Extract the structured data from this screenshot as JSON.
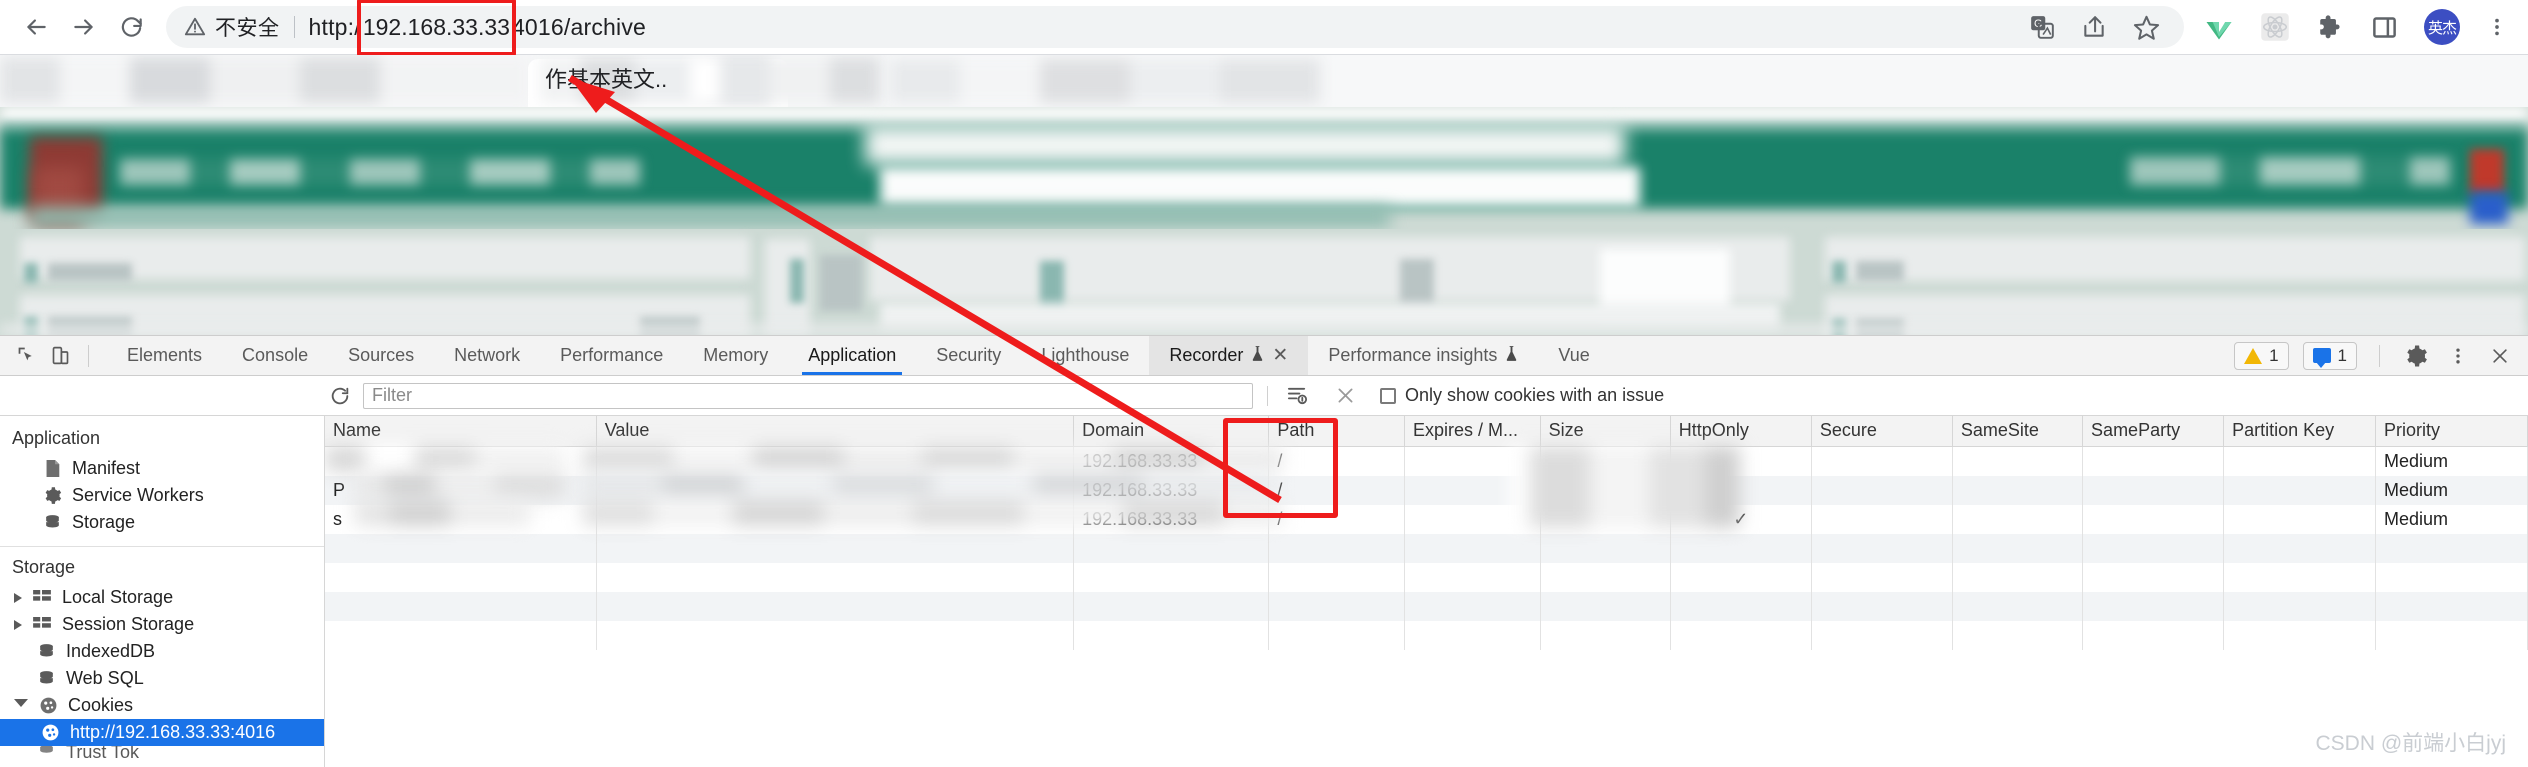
{
  "browser": {
    "nav": {
      "back_icon": "arrow-left-icon",
      "forward_icon": "arrow-right-icon",
      "reload_icon": "reload-icon"
    },
    "omnibox": {
      "security_label": "不安全",
      "warning_icon": "warning-triangle-icon",
      "url_prefix": "http:/",
      "url_highlight": "192.168.33.33",
      "url_suffix": "4016/archive",
      "translate_icon": "google-translate-icon",
      "share_icon": "share-icon",
      "bookmark_icon": "star-icon"
    },
    "actions": [
      {
        "name": "vue-devtools-icon",
        "label": "Vue"
      },
      {
        "name": "react-devtools-icon",
        "label": "React"
      },
      {
        "name": "extensions-puzzle-icon",
        "label": "Extensions"
      },
      {
        "name": "side-panel-icon",
        "label": "Side panel"
      },
      {
        "name": "profile-avatar",
        "label": "英杰"
      },
      {
        "name": "chrome-menu-icon",
        "label": "⋮"
      }
    ],
    "tab": {
      "title": "作基本英文.."
    }
  },
  "devtools": {
    "tools": {
      "inspect_icon": "inspect-element-icon",
      "device_icon": "device-toolbar-icon"
    },
    "tabs": [
      {
        "label": "Elements",
        "active": false,
        "flask": false,
        "closeable": false
      },
      {
        "label": "Console",
        "active": false,
        "flask": false,
        "closeable": false
      },
      {
        "label": "Sources",
        "active": false,
        "flask": false,
        "closeable": false
      },
      {
        "label": "Network",
        "active": false,
        "flask": false,
        "closeable": false
      },
      {
        "label": "Performance",
        "active": false,
        "flask": false,
        "closeable": false
      },
      {
        "label": "Memory",
        "active": false,
        "flask": false,
        "closeable": false
      },
      {
        "label": "Application",
        "active": true,
        "flask": false,
        "closeable": false
      },
      {
        "label": "Security",
        "active": false,
        "flask": false,
        "closeable": false
      },
      {
        "label": "Lighthouse",
        "active": false,
        "flask": false,
        "closeable": false
      },
      {
        "label": "Recorder",
        "active": false,
        "flask": true,
        "closeable": true,
        "boxed": true
      },
      {
        "label": "Performance insights",
        "active": false,
        "flask": true,
        "closeable": false
      },
      {
        "label": "Vue",
        "active": false,
        "flask": false,
        "closeable": false
      }
    ],
    "status": {
      "warning_count": "1",
      "message_count": "1",
      "settings_icon": "gear-icon",
      "more_icon": "more-vertical-icon",
      "close_icon": "close-icon"
    },
    "filterbar": {
      "refresh_icon": "refresh-icon",
      "filter_placeholder": "Filter",
      "filter_value": "",
      "clear_cookies_icon": "clear-cookies-icon",
      "clear_filter_icon": "clear-x-icon",
      "issue_checkbox_label": "Only show cookies with an issue",
      "issue_checkbox_checked": false
    },
    "sidebar": {
      "application_title": "Application",
      "application_items": [
        {
          "label": "Manifest",
          "icon": "manifest-file-icon"
        },
        {
          "label": "Service Workers",
          "icon": "gear-icon"
        },
        {
          "label": "Storage",
          "icon": "database-icon"
        }
      ],
      "storage_title": "Storage",
      "storage_items": [
        {
          "label": "Local Storage",
          "icon": "grid-storage-icon",
          "arrow": "collapsed"
        },
        {
          "label": "Session Storage",
          "icon": "grid-storage-icon",
          "arrow": "collapsed"
        },
        {
          "label": "IndexedDB",
          "icon": "database-icon",
          "arrow": "none"
        },
        {
          "label": "Web SQL",
          "icon": "database-icon",
          "arrow": "none"
        },
        {
          "label": "Cookies",
          "icon": "cookie-icon",
          "arrow": "expanded"
        }
      ],
      "cookie_origin": {
        "label": "http://192.168.33.33:4016",
        "icon": "cookie-icon",
        "selected": true
      },
      "next_item_partial": "Trust Tok"
    },
    "table": {
      "columns": [
        "Name",
        "Value",
        "Domain",
        "Path",
        "Expires / M...",
        "Size",
        "HttpOnly",
        "Secure",
        "SameSite",
        "SameParty",
        "Partition Key",
        "Priority"
      ],
      "rows": [
        {
          "Name": "",
          "Value": "",
          "Domain": "192.168.33.33",
          "Path": "/",
          "Expires / M...": "",
          "Size": "",
          "HttpOnly": "",
          "Secure": "",
          "SameSite": "",
          "SameParty": "",
          "Partition Key": "",
          "Priority": "Medium"
        },
        {
          "Name": "P",
          "Value": "",
          "Domain": "192.168.33.33",
          "Path": "/",
          "Expires / M...": "",
          "Size": "",
          "HttpOnly": "",
          "Secure": "",
          "SameSite": "",
          "SameParty": "",
          "Partition Key": "",
          "Priority": "Medium"
        },
        {
          "Name": "s",
          "Value": "",
          "Domain": "192.168.33.33",
          "Path": "/",
          "Expires / M...": "",
          "Size": "",
          "HttpOnly": "✓",
          "Secure": "",
          "SameSite": "",
          "SameParty": "",
          "Partition Key": "",
          "Priority": "Medium"
        }
      ]
    }
  },
  "annotations": {
    "url_box_color": "#ee1c1c",
    "domain_box_color": "#ee1c1c",
    "arrow_color": "#ee1c1c"
  },
  "watermark": "CSDN @前端小白jyj"
}
